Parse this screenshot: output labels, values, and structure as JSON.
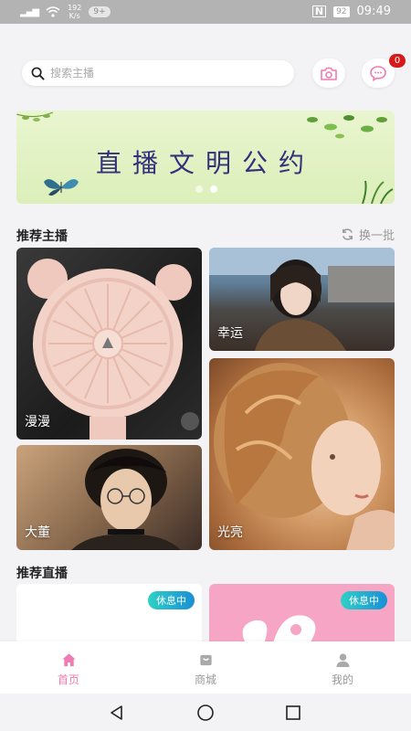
{
  "status_bar": {
    "network_speed_value": "192",
    "network_speed_unit": "K/s",
    "notification_badge": "9+",
    "battery": "92",
    "time": "09:49"
  },
  "search": {
    "placeholder": "搜索主播"
  },
  "messages": {
    "unread_count": "0"
  },
  "banner": {
    "title": "直播文明公约",
    "slide_count": 2,
    "active_slide": 2
  },
  "recommended_hosts": {
    "title": "推荐主播",
    "refresh_label": "换一批",
    "hosts": [
      {
        "name": "漫漫"
      },
      {
        "name": "幸运"
      },
      {
        "name": "大董"
      },
      {
        "name": "光亮"
      }
    ]
  },
  "recommended_live": {
    "title": "推荐直播",
    "items": [
      {
        "status": "休息中"
      },
      {
        "status": "休息中"
      }
    ]
  },
  "tab_bar": {
    "tabs": [
      {
        "label": "首页",
        "icon": "home-icon",
        "active": true
      },
      {
        "label": "商城",
        "icon": "shop-icon",
        "active": false
      },
      {
        "label": "我的",
        "icon": "profile-icon",
        "active": false
      }
    ]
  },
  "colors": {
    "accent": "#f07ab2",
    "banner_text": "#35307a",
    "badge": "#d61a1a"
  }
}
